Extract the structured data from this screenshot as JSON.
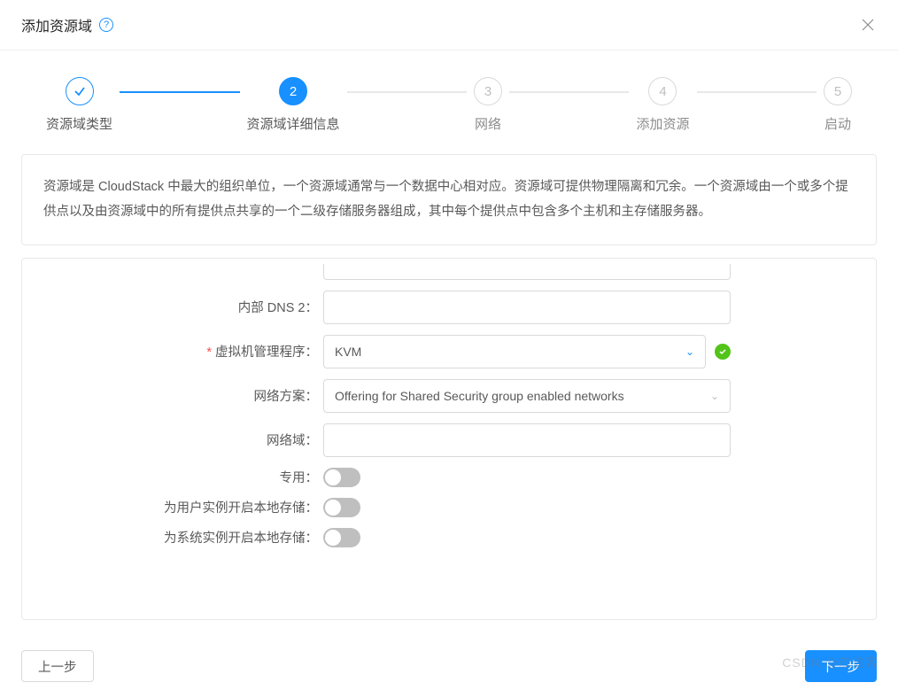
{
  "modal": {
    "title": "添加资源域",
    "help_icon": "help-icon",
    "close_icon": "close-icon"
  },
  "steps": [
    {
      "label": "资源域类型",
      "state": "finish",
      "icon": "check"
    },
    {
      "label": "资源域详细信息",
      "state": "process",
      "icon": "2"
    },
    {
      "label": "网络",
      "state": "wait",
      "icon": "3"
    },
    {
      "label": "添加资源",
      "state": "wait",
      "icon": "4"
    },
    {
      "label": "启动",
      "state": "wait",
      "icon": "5"
    }
  ],
  "description": "资源域是 CloudStack 中最大的组织单位，一个资源域通常与一个数据中心相对应。资源域可提供物理隔离和冗余。一个资源域由一个或多个提供点以及由资源域中的所有提供点共享的一个二级存储服务器组成，其中每个提供点中包含多个主机和主存储服务器。",
  "form": {
    "internal_dns2_label": "内部 DNS 2：",
    "internal_dns2_value": "",
    "hypervisor_label": "虚拟机管理程序：",
    "hypervisor_value": "KVM",
    "network_offering_label": "网络方案：",
    "network_offering_value": "Offering for Shared Security group enabled networks",
    "network_domain_label": "网络域：",
    "network_domain_value": "",
    "dedicated_label": "专用：",
    "local_storage_user_label": "为用户实例开启本地存储：",
    "local_storage_system_label": "为系统实例开启本地存储："
  },
  "footer": {
    "prev_label": "上一步",
    "next_label": "下一步"
  },
  "watermark": "CSDN @旅途客",
  "colors": {
    "primary": "#1890ff",
    "success": "#52c41a",
    "border": "#d9d9d9"
  }
}
